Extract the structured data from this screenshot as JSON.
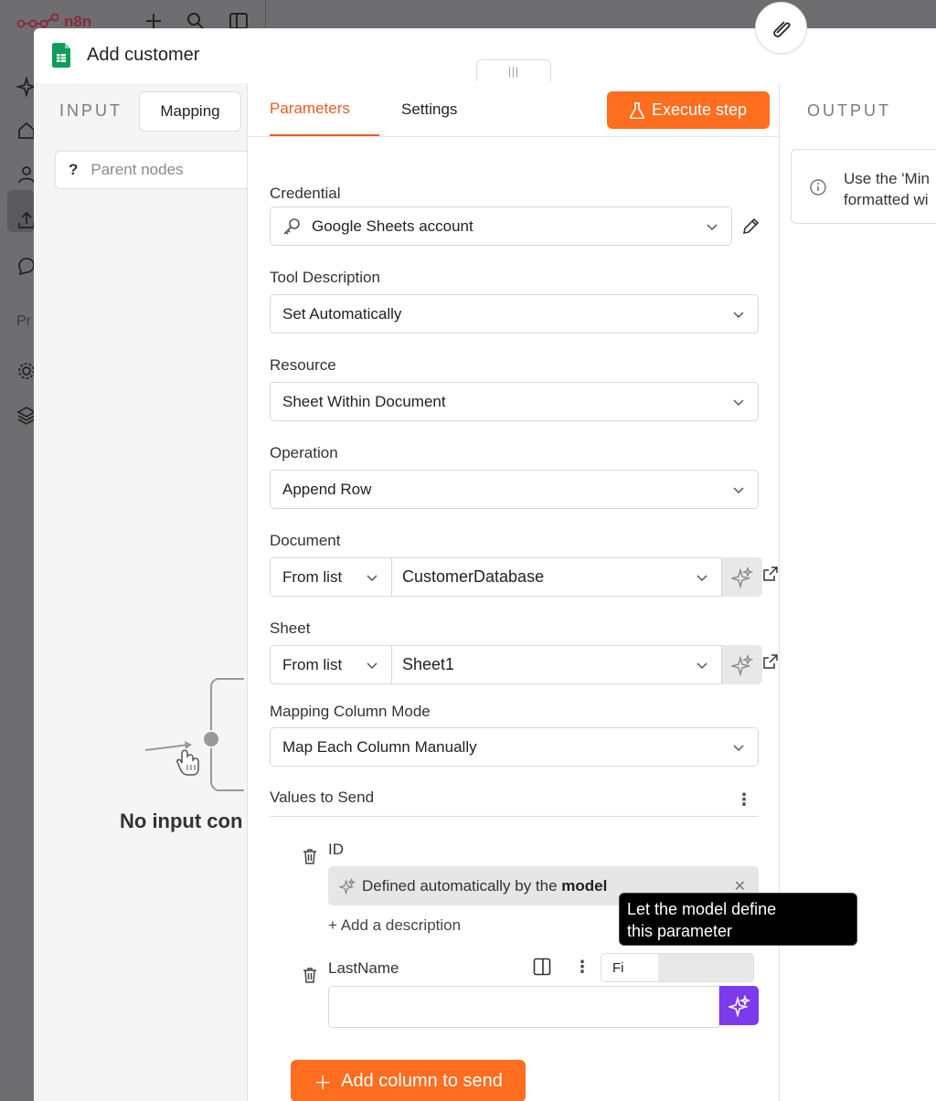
{
  "app": {
    "name": "n8n",
    "sidebar_partial_text": "Pr"
  },
  "modal": {
    "title": "Add customer",
    "drag_handle": "|||"
  },
  "input_panel": {
    "label": "INPUT",
    "mapping_tab": "Mapping",
    "parent_nodes_q": "?",
    "parent_nodes": "Parent nodes",
    "empty_message": "No input con"
  },
  "tabs": [
    {
      "label": "Parameters",
      "active": true
    },
    {
      "label": "Settings",
      "active": false
    }
  ],
  "execute_button": "Execute step",
  "fields": {
    "credential": {
      "label": "Credential",
      "value": "Google Sheets account"
    },
    "tool_description": {
      "label": "Tool Description",
      "value": "Set Automatically"
    },
    "resource": {
      "label": "Resource",
      "value": "Sheet Within Document"
    },
    "operation": {
      "label": "Operation",
      "value": "Append Row"
    },
    "document": {
      "label": "Document",
      "mode": "From list",
      "value": "CustomerDatabase"
    },
    "sheet": {
      "label": "Sheet",
      "mode": "From list",
      "value": "Sheet1"
    },
    "mapping_mode": {
      "label": "Mapping Column Mode",
      "value": "Map Each Column Manually"
    }
  },
  "values_to_send": {
    "label": "Values to Send",
    "columns": [
      {
        "name": "ID",
        "auto_prefix": "Defined automatically by the",
        "auto_bold": "model",
        "add_description": "+ Add a description"
      },
      {
        "name": "LastName",
        "mode": "Fi",
        "value": ""
      }
    ],
    "add_button": "Add column to send"
  },
  "tooltip": {
    "text_line1": "Let the model define",
    "text_line2": "this parameter"
  },
  "output_panel": {
    "label": "OUTPUT",
    "info_line1": "Use the 'Min",
    "info_line2": "formatted wi"
  },
  "colors": {
    "accent_orange": "#ff6d1f",
    "tab_active": "#ea5c20",
    "ai_purple": "#7c3aed",
    "sheets_green": "#0f9d58"
  }
}
